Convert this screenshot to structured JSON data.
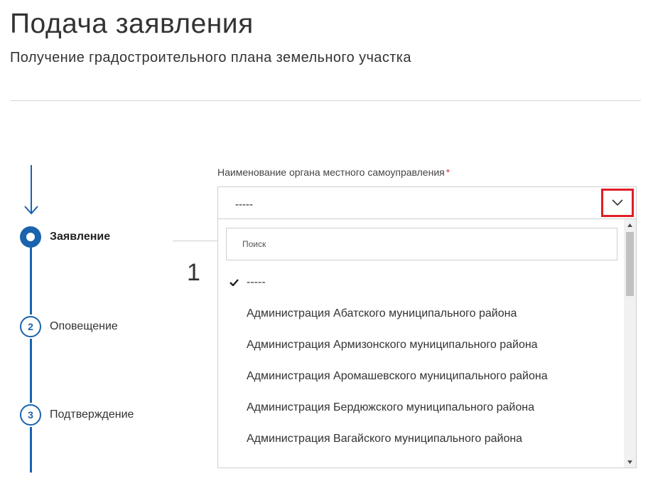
{
  "header": {
    "title": "Подача заявления",
    "subtitle": "Получение градостроительного плана земельного участка"
  },
  "stepper": {
    "steps": [
      {
        "number": "",
        "label": "Заявление",
        "state": "active"
      },
      {
        "number": "2",
        "label": "Оповещение",
        "state": "pending"
      },
      {
        "number": "3",
        "label": "Подтверждение",
        "state": "pending"
      }
    ]
  },
  "section": {
    "number": "1"
  },
  "field": {
    "label": "Наименование органа местного самоуправления",
    "required_mark": "*",
    "selected_value": "-----"
  },
  "dropdown": {
    "search_placeholder": "Поиск",
    "options": [
      {
        "label": "-----",
        "selected": true
      },
      {
        "label": "Администрация Абатского муниципального района",
        "selected": false
      },
      {
        "label": "Администрация Армизонского муниципального района",
        "selected": false
      },
      {
        "label": "Администрация Аромашевского муниципального района",
        "selected": false
      },
      {
        "label": "Администрация Бердюжского муниципального района",
        "selected": false
      },
      {
        "label": "Администрация Вагайского муниципального района",
        "selected": false
      }
    ]
  },
  "colors": {
    "accent": "#1a63ad",
    "highlight": "#e01e26",
    "required": "#d83a3a"
  },
  "icons": {
    "toggle": "chevron-down-icon",
    "selected": "check-icon",
    "stepper": "arrow-down-icon"
  }
}
